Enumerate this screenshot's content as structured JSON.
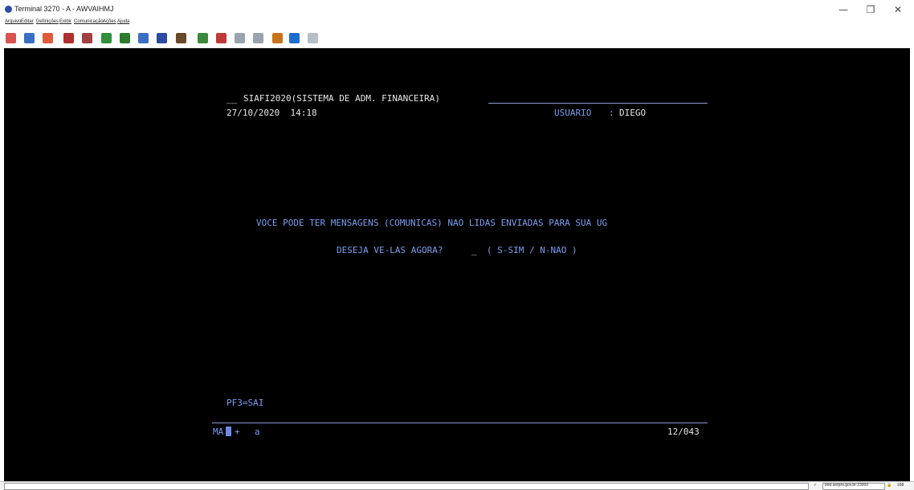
{
  "window": {
    "title": "Terminal 3270 - A - AWVAIHMJ",
    "controls": {
      "minimize": "—",
      "restore": "❐",
      "close": "✕"
    }
  },
  "menu": [
    "Arquivo",
    "Editar",
    "Definições",
    "Exibir",
    "Comunicação",
    "Ações",
    "Ajuda"
  ],
  "toolbar": {
    "icons": [
      {
        "name": "send-icon",
        "color": "#d9534f"
      },
      {
        "name": "receive-icon",
        "color": "#3a6fc4"
      },
      {
        "name": "exit-icon",
        "color": "#e05a3c"
      },
      {
        "name": "print-screen-icon",
        "color": "#b03030"
      },
      {
        "name": "print-icon",
        "color": "#a04040"
      },
      {
        "name": "copy-icon",
        "color": "#2f8f3a"
      },
      {
        "name": "paste-icon",
        "color": "#2c7a2c"
      },
      {
        "name": "copy-append-icon",
        "color": "#3a6fc4"
      },
      {
        "name": "keypad-icon",
        "color": "#2b4aa0"
      },
      {
        "name": "macro-icon",
        "color": "#6a4a2a"
      },
      {
        "name": "record-macro-icon",
        "color": "#3a8a3a"
      },
      {
        "name": "play-macro-icon",
        "color": "#c03838"
      },
      {
        "name": "stop-macro-icon",
        "color": "#9aa3ad"
      },
      {
        "name": "pause-macro-icon",
        "color": "#9aa3ad"
      },
      {
        "name": "link-icon",
        "color": "#c8731a"
      },
      {
        "name": "transfer-icon",
        "color": "#1f6ccf"
      },
      {
        "name": "refresh-icon",
        "color": "#b8bec6"
      }
    ]
  },
  "screen": {
    "header_prefix": "__",
    "header_title": "SIAFI2020(SISTEMA DE ADM. FINANCEIRA)",
    "datetime": "27/10/2020  14:18",
    "user_label": "USUARIO",
    "user_sep": ":",
    "user_name": "DIEGO",
    "message": "VOCE PODE TER MENSAGENS (COMUNICAS) NAO LIDAS ENVIADAS PARA SUA UG",
    "prompt": "DESEJA VE-LAS AGORA?",
    "input_value": "_",
    "options": "( S-SIM / N-NAO )",
    "pf_key": "PF3=SAI"
  },
  "oia": {
    "mode": "MA",
    "plus": "+",
    "session": "a",
    "cursor_pos": "12/043"
  },
  "statusbar": {
    "host_text": "bod.serpro.gov.br:23000",
    "port_text": "168",
    "connected_icon": "check-icon",
    "lock_icon": "lock-icon"
  },
  "colors": {
    "terminal_bg": "#000000",
    "text_white": "#e8e8e8",
    "text_blue": "#7d9ff2",
    "line": "#8e9ad8"
  }
}
